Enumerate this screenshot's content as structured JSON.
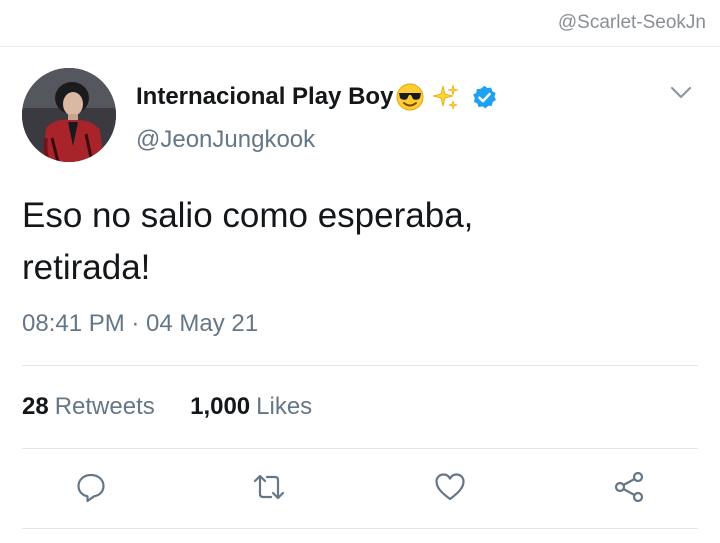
{
  "watermark": "@Scarlet-SeokJn",
  "tweet": {
    "display_name": "Internacional Play Boy",
    "handle": "@JeonJungkook",
    "text_line1": "Eso no salio como esperaba,",
    "text_line2": "retirada!",
    "timestamp": "08:41 PM · 04 May 21",
    "retweets_count": "28",
    "retweets_label": "Retweets",
    "likes_count": "1,000",
    "likes_label": "Likes"
  },
  "icons": {
    "avatar": "profile-photo",
    "name_emoji_1": "sunglasses-face-emoji",
    "name_emoji_2": "sparkles-emoji",
    "verified": "verified-badge-icon",
    "more": "chevron-down-icon",
    "reply": "reply-icon",
    "retweet": "retweet-icon",
    "like": "heart-icon",
    "share": "share-icon"
  },
  "colors": {
    "text_primary": "#14171a",
    "text_secondary": "#657786",
    "verified_blue": "#1da1f2",
    "divider": "#e1e8ed"
  }
}
